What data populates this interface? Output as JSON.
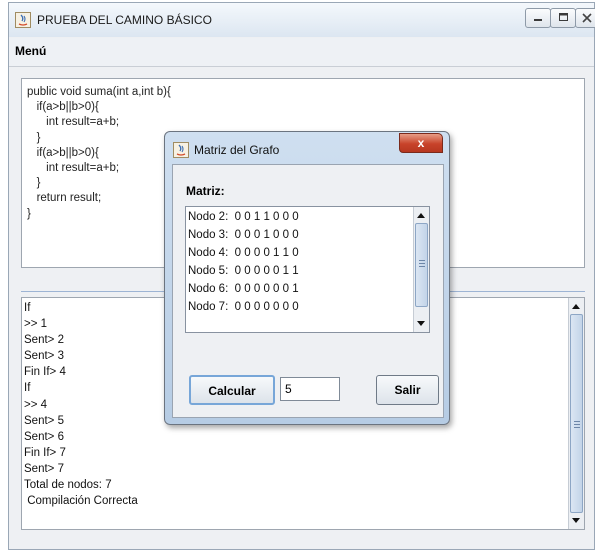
{
  "window": {
    "title": "PRUEBA DEL CAMINO BÁSICO",
    "menu": "Menú"
  },
  "code_lines": [
    "public void suma(int a,int b){",
    "   if(a>b||b>0){",
    "      int result=a+b;",
    "   }",
    "   if(a>b||b>0){",
    "      int result=a+b;",
    "   }",
    "   return result;",
    "}"
  ],
  "output_lines": [
    "If",
    ">> 1",
    "Sent> 2",
    "Sent> 3",
    "Fin If> 4",
    "If",
    ">> 4",
    "Sent> 5",
    "Sent> 6",
    "Fin If> 7",
    "Sent> 7",
    "Total de nodos: 7",
    " Compilación Correcta"
  ],
  "dialog": {
    "title": "Matriz del Grafo",
    "close_glyph": "x",
    "matrix_label": "Matriz:",
    "rows": [
      "Nodo 2:  0 0 1 1 0 0 0",
      "Nodo 3:  0 0 0 1 0 0 0",
      "Nodo 4:  0 0 0 0 1 1 0",
      "Nodo 5:  0 0 0 0 0 1 1",
      "Nodo 6:  0 0 0 0 0 0 1",
      "Nodo 7:  0 0 0 0 0 0 0"
    ],
    "calc_label": "Calcular",
    "input_value": "5",
    "exit_label": "Salir"
  },
  "icons": [
    "java-app-icon",
    "minimize-icon",
    "maximize-icon",
    "close-icon"
  ]
}
